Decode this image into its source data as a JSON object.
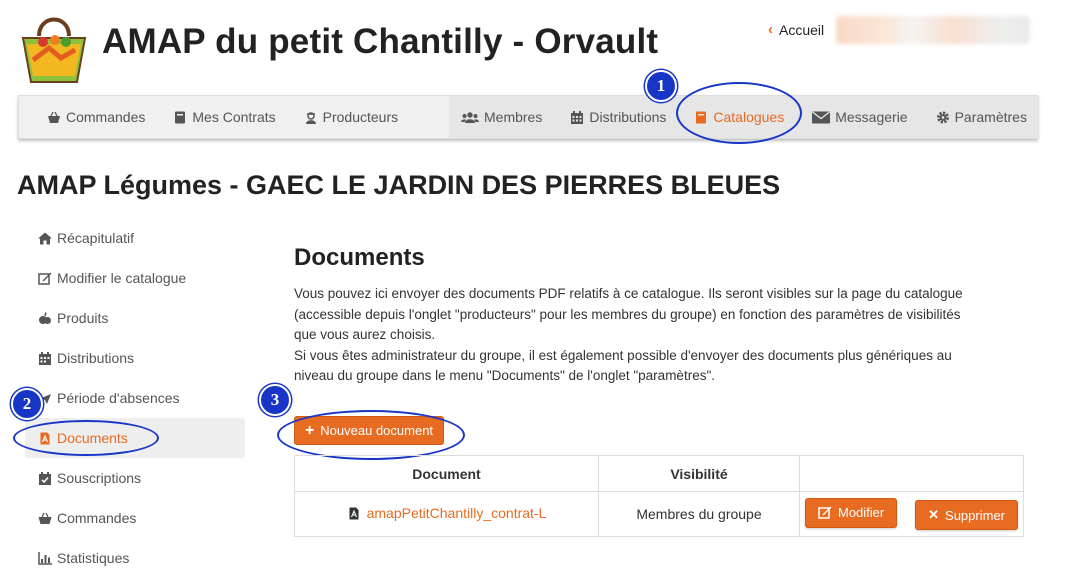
{
  "header": {
    "title": "AMAP du petit Chantilly - Orvault",
    "home_label": "Accueil"
  },
  "nav": {
    "left": [
      {
        "label": "Commandes",
        "icon": "basket-icon"
      },
      {
        "label": "Mes Contrats",
        "icon": "book-icon"
      },
      {
        "label": "Producteurs",
        "icon": "farmer-icon"
      }
    ],
    "right": [
      {
        "label": "Membres",
        "icon": "users-icon"
      },
      {
        "label": "Distributions",
        "icon": "calendar-icon"
      },
      {
        "label": "Catalogues",
        "icon": "book-icon",
        "active": true
      },
      {
        "label": "Messagerie",
        "icon": "envelope-icon"
      },
      {
        "label": "Paramètres",
        "icon": "gear-icon"
      }
    ]
  },
  "page": {
    "title": "AMAP Légumes - GAEC LE JARDIN DES PIERRES BLEUES"
  },
  "sidebar": {
    "items": [
      {
        "label": "Récapitulatif",
        "icon": "home-icon"
      },
      {
        "label": "Modifier le catalogue",
        "icon": "edit-icon"
      },
      {
        "label": "Produits",
        "icon": "fruit-icon"
      },
      {
        "label": "Distributions",
        "icon": "calendar-icon"
      },
      {
        "label": "Période d'absences",
        "icon": "plane-icon"
      },
      {
        "label": "Documents",
        "icon": "pdf-icon",
        "active": true
      },
      {
        "label": "Souscriptions",
        "icon": "calendar-check-icon"
      },
      {
        "label": "Commandes",
        "icon": "basket-icon"
      },
      {
        "label": "Statistiques",
        "icon": "chart-icon"
      }
    ]
  },
  "documents": {
    "title": "Documents",
    "paragraph1_line1": "Vous pouvez ici envoyer des documents PDF relatifs à ce catalogue. Ils seront visibles sur la page du catalogue",
    "paragraph1_line2": "(accessible depuis l'onglet \"producteurs\" pour les membres du groupe) en fonction des paramètres de visibilités",
    "paragraph1_line3": "que vous aurez choisis.",
    "paragraph2_line1": "Si vous êtes administrateur du groupe, il est également possible d'envoyer des documents plus génériques au",
    "paragraph2_line2": "niveau du groupe dans le menu \"Documents\" de l'onglet \"paramètres\".",
    "new_button": "Nouveau document",
    "columns": [
      "Document",
      "Visibilité",
      ""
    ],
    "rows": [
      {
        "name": "amapPetitChantilly_contrat-L",
        "visibility": "Membres du groupe",
        "edit": "Modifier",
        "delete": "Supprimer"
      }
    ]
  },
  "annotations": [
    "1",
    "2",
    "3"
  ],
  "colors": {
    "accent": "#e86b22",
    "annotation": "#1736c7"
  }
}
